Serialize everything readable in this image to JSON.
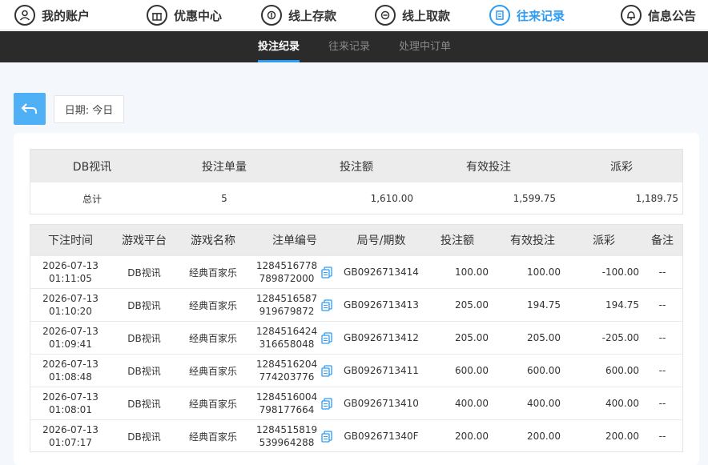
{
  "nav": [
    {
      "label": "我的账户",
      "icon": "user-icon"
    },
    {
      "label": "优惠中心",
      "icon": "gift-icon"
    },
    {
      "label": "线上存款",
      "icon": "deposit-icon"
    },
    {
      "label": "线上取款",
      "icon": "withdraw-icon"
    },
    {
      "label": "往来记录",
      "icon": "records-icon",
      "active": true
    },
    {
      "label": "信息公告",
      "icon": "bell-icon"
    }
  ],
  "subtabs": [
    {
      "label": "投注纪录",
      "active": true
    },
    {
      "label": "往来记录"
    },
    {
      "label": "处理中订单"
    }
  ],
  "date_filter": "日期: 今日",
  "summary": {
    "headers": [
      "DB视讯",
      "投注单量",
      "投注额",
      "有效投注",
      "派彩"
    ],
    "row": [
      "总计",
      "5",
      "1,610.00",
      "1,599.75",
      "1,189.75"
    ]
  },
  "records": {
    "headers": [
      "下注时间",
      "游戏平台",
      "游戏名称",
      "注单编号",
      "局号/期数",
      "投注额",
      "有效投注",
      "派彩",
      "备注"
    ],
    "rows": [
      {
        "date": "2026-07-13",
        "time": "01:11:05",
        "platform": "DB视讯",
        "game": "经典百家乐",
        "id1": "1284516778",
        "id2": "789872000",
        "round": "GB0926713414",
        "bet": "100.00",
        "valid": "100.00",
        "payout": "-100.00",
        "negative": true,
        "note": "--"
      },
      {
        "date": "2026-07-13",
        "time": "01:10:20",
        "platform": "DB视讯",
        "game": "经典百家乐",
        "id1": "1284516587",
        "id2": "919679872",
        "round": "GB0926713413",
        "bet": "205.00",
        "valid": "194.75",
        "payout": "194.75",
        "negative": false,
        "note": "--"
      },
      {
        "date": "2026-07-13",
        "time": "01:09:41",
        "platform": "DB视讯",
        "game": "经典百家乐",
        "id1": "1284516424",
        "id2": "316658048",
        "round": "GB0926713412",
        "bet": "205.00",
        "valid": "205.00",
        "payout": "-205.00",
        "negative": true,
        "note": "--"
      },
      {
        "date": "2026-07-13",
        "time": "01:08:48",
        "platform": "DB视讯",
        "game": "经典百家乐",
        "id1": "1284516204",
        "id2": "774203776",
        "round": "GB0926713411",
        "bet": "600.00",
        "valid": "600.00",
        "payout": "600.00",
        "negative": false,
        "note": "--"
      },
      {
        "date": "2026-07-13",
        "time": "01:08:01",
        "platform": "DB视讯",
        "game": "经典百家乐",
        "id1": "1284516004",
        "id2": "798177664",
        "round": "GB0926713410",
        "bet": "400.00",
        "valid": "400.00",
        "payout": "400.00",
        "negative": false,
        "note": "--"
      },
      {
        "date": "2026-07-13",
        "time": "01:07:17",
        "platform": "DB视讯",
        "game": "经典百家乐",
        "id1": "1284515819",
        "id2": "539964288",
        "round": "GB092671340F",
        "bet": "200.00",
        "valid": "200.00",
        "payout": "200.00",
        "negative": false,
        "note": "--"
      }
    ]
  },
  "colors": {
    "accent": "#2e9cf4",
    "negative": "#e0607a",
    "subnav_bg": "#2b2b2b"
  }
}
